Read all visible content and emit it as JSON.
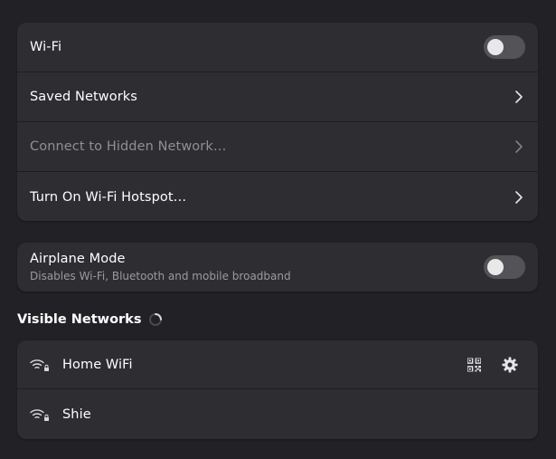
{
  "wifi_card": {
    "wifi_label": "Wi-Fi",
    "wifi_enabled": false,
    "saved_networks_label": "Saved Networks",
    "hidden_network_label": "Connect to Hidden Network…",
    "hotspot_label": "Turn On Wi-Fi Hotspot…"
  },
  "airplane_card": {
    "title": "Airplane Mode",
    "subtitle": "Disables Wi-Fi, Bluetooth and mobile broadband",
    "enabled": false
  },
  "visible_networks": {
    "title": "Visible Networks",
    "networks": [
      {
        "name": "Home WiFi",
        "icon": "wifi-secured-icon",
        "show_qr": true,
        "show_settings": true
      },
      {
        "name": "Shie",
        "icon": "wifi-secured-icon",
        "show_qr": false,
        "show_settings": false
      }
    ]
  },
  "colors": {
    "background": "#222226",
    "card": "#2e2e32",
    "toggle_off": "#545458",
    "text": "#ffffff",
    "text_dim": "#8f8f94"
  }
}
